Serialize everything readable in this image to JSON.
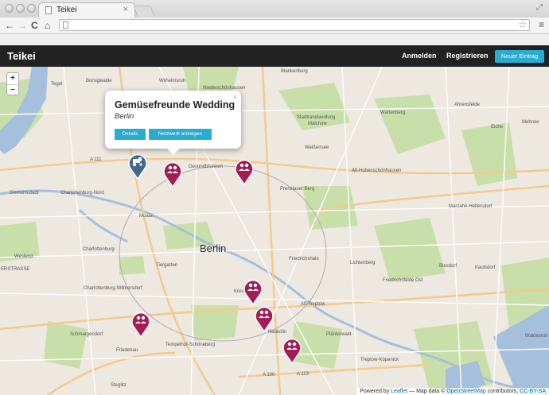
{
  "browser": {
    "tab_title": "Teikei",
    "tab_close": "×",
    "url": "",
    "back": "←",
    "forward": "→",
    "reload": "C",
    "home": "⌂",
    "star": "☆",
    "menu": "≡"
  },
  "navbar": {
    "brand": "Teikei",
    "login": "Anmelden",
    "register": "Registrieren",
    "new_entry": "Neuer Eintrag"
  },
  "map": {
    "zoom_in": "+",
    "zoom_out": "−",
    "places": {
      "berlin": "Berlin",
      "blankenburg": "Blankenburg",
      "tegel": "Tegel",
      "borsigwalde": "Borsigwalde",
      "wilhelmsruh": "Wilhelmsruh",
      "niederschoenhausen": "Niederschönhausen",
      "stadtrandsiedlung": "Stadtrandsiedlung",
      "malchow": "Malchow",
      "wartenberg": "Wartenberg",
      "ahrensfelde": "Ahrensfelde",
      "eiche": "Eiche",
      "mehrow": "Mehrow",
      "weissensee": "Weißensee",
      "althohenschoenhausen": "Alt-Hohenschönhausen",
      "gesundbrunnen": "Gesundbrunnen",
      "prenzlauer_berg": "Prenzlauer Berg",
      "siemensstadt": "Siemensstadt",
      "charlottenburg_nord": "Charlottenburg-Nord",
      "moabit": "Moabit",
      "marzahn": "Marzahn-Hellersdorf",
      "lichtenberg": "Lichtenberg",
      "westend": "Westend",
      "charlottenburg": "Charlottenburg",
      "friedrichshain": "Friedrichshain",
      "biesdorf": "Biesdorf",
      "kaulsdorf": "Kaulsdorf",
      "friedrichsfelde": "Friedrichsfelde Ost",
      "charlottenburg_wilmersdorf": "Charlottenburg-Wilmersdorf",
      "kreuzberg": "Kreuzberg",
      "alt_treptow": "Alt-Treptow",
      "schmargendorf": "Schmargendorf",
      "friedenau": "Friedenau",
      "tempelhof_schoeneberg": "Tempelhof-Schöneberg",
      "neukoelln": "Neukölln",
      "plaenterwald": "Plänterwald",
      "treptow_koepenick": "Treptow-Köpenick",
      "waldesruh": "Waldesruh",
      "steglitz": "Steglitz",
      "a111": "A 111",
      "a100": "A 100",
      "a113": "A 113",
      "erstrasse": "ERSTRASSE",
      "tiergarten": "Tiergarten"
    },
    "popup": {
      "title": "Gemüsefreunde Wedding",
      "subtitle": "Berlin",
      "close": "×",
      "details_button": "Details",
      "network_button": "Netzwerk anzeigen"
    },
    "attribution": {
      "powered_by": "Powered by",
      "leaflet": "Leaflet",
      "map_data": "— Map data ©",
      "osm": "OpenStreetMap",
      "contributors": "contributors,",
      "license": "CC-BY-SA"
    },
    "colors": {
      "marker_depot": "#a51c55",
      "marker_farm": "#3c6b8e",
      "water": "#a5bfdd",
      "green": "#c9dfaa",
      "button": "#2aabd2"
    }
  }
}
